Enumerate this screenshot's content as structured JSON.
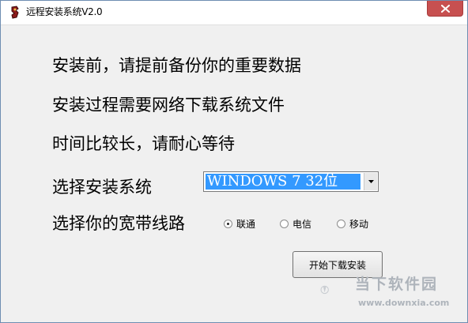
{
  "window": {
    "title": "远程安装系统V2.0",
    "close_icon": "close-icon",
    "app_icon": "app-icon"
  },
  "info_lines": [
    "安装前，请提前备份你的重要数据",
    "安装过程需要网络下载系统文件",
    "时间比较长，请耐心等待"
  ],
  "system_select": {
    "label": "选择安装系统",
    "value": "WINDOWS 7 32位",
    "arrow_icon": "chevron-down-icon"
  },
  "broadband": {
    "label": "选择你的宽带线路",
    "options": [
      {
        "label": "联通",
        "selected": true
      },
      {
        "label": "电信",
        "selected": false
      },
      {
        "label": "移动",
        "selected": false
      }
    ]
  },
  "start_button": {
    "label": "开始下载安装"
  },
  "watermark": {
    "name": "当下软件园",
    "url": "www.downxia.com"
  },
  "colors": {
    "close": "#c75050",
    "selection": "#3399ff",
    "background": "#f0f0f0"
  }
}
